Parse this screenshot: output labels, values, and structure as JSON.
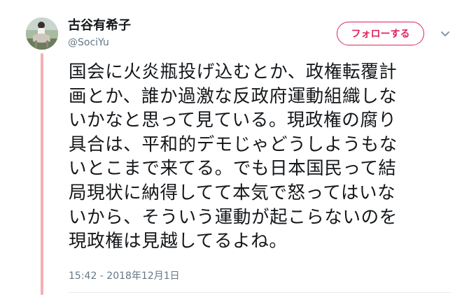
{
  "user": {
    "display_name": "古谷有希子",
    "handle": "@SociYu",
    "avatar_icon": "avatar-photo"
  },
  "follow_button": {
    "label": "フォローする"
  },
  "menu": {
    "icon": "chevron-down-icon"
  },
  "tweet": {
    "text": "国会に火炎瓶投げ込むとか、政権転覆計\n画とか、誰か過激な反政府運動組織しな\nいかなと思って見ている。現政権の腐り\n具合は、平和的デモじゃどうしようもな\nいとこまで来てる。でも日本国民って結\n局現状に納得してて本気で怒ってはいな\nいから、そういう運動が起こらないのを\n現政権は見越してるよね。",
    "timestamp": "15:42 - 2018年12月1日"
  },
  "colors": {
    "accent": "#e0245e",
    "thread_line": "#f3b1b7",
    "text": "#14171a",
    "secondary_text": "#657786"
  }
}
